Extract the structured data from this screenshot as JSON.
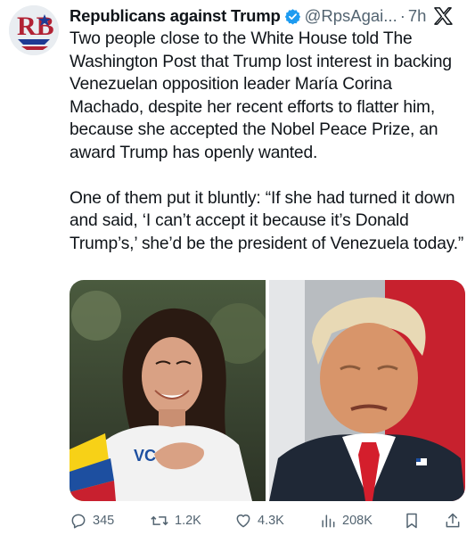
{
  "tweet": {
    "display_name": "Republicans against Trump",
    "handle": "@RpsAgai...",
    "separator": "·",
    "time": "7h",
    "avatar_letters": "RB",
    "paragraphs": [
      "Two people close to the White House told The Washington Post that Trump lost interest in backing Venezuelan opposition leader María Corina Machado, despite her recent efforts to flatter him, because she accepted the Nobel Peace Prize, an award Trump has openly wanted.",
      "One of them put it bluntly: “If she had turned it down and said, ‘I can’t accept it because it’s Donald Trump’s,’ she’d be the president of Venezuela today.”"
    ],
    "media": [
      {
        "description": "photo-woman-hand-on-chest"
      },
      {
        "description": "photo-man-red-tie"
      }
    ],
    "actions": {
      "replies": "345",
      "reposts": "1.2K",
      "likes": "4.3K",
      "views": "208K"
    },
    "icons": {
      "verified": "verified-badge-icon",
      "x_logo": "x-logo-icon",
      "reply": "reply-icon",
      "repost": "repost-icon",
      "like": "heart-icon",
      "views": "views-icon",
      "bookmark": "bookmark-icon",
      "share": "share-icon"
    },
    "colors": {
      "text": "#0f1419",
      "secondary": "#536471",
      "verified_blue": "#1d9bf0"
    }
  }
}
